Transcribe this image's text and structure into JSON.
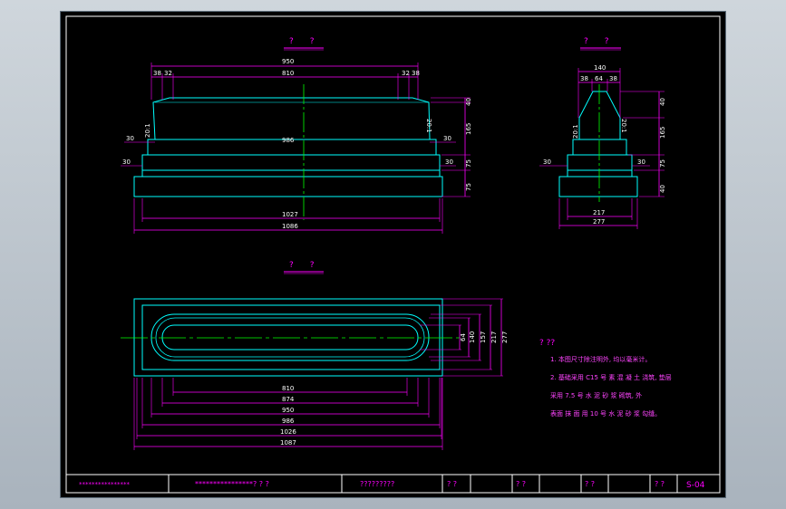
{
  "colors": {
    "background": "#000000",
    "frame": "#ffffff",
    "outline": "#00ffff",
    "dimension": "#ff00ff",
    "centerline": "#00ff00",
    "text": "#ffffff"
  },
  "views": {
    "front_title": "?　　?",
    "side_title": "?　　?",
    "plan_title": "?　　?"
  },
  "front_dims": {
    "top_width": "950",
    "inner_width": "810",
    "left_38": "38",
    "left_32": "32",
    "right_32": "32",
    "right_38": "38",
    "slope_left": "20:1",
    "slope_right": "20:1",
    "shoulder_left": "30",
    "shoulder_right": "30",
    "mid_width": "986",
    "base_width": "1027",
    "overall_width": "1086",
    "h_40": "40",
    "h_165": "165",
    "h_75a": "75",
    "h_75b": "75"
  },
  "side_dims": {
    "top_width": "140",
    "d38a": "38",
    "d64": "64",
    "d38b": "38",
    "slope_left": "20:1",
    "slope_right": "20:1",
    "step_left": "30",
    "step_right": "30",
    "h_40": "40",
    "h_165": "165",
    "h_75": "75",
    "h_40b": "40",
    "width_217": "217",
    "width_277": "277"
  },
  "plan_dims": {
    "w810": "810",
    "w874": "874",
    "w950": "950",
    "w986": "986",
    "w1026": "1026",
    "w1087": "1087",
    "v64": "64",
    "v140": "140",
    "v157": "157",
    "v217": "217",
    "v277": "277"
  },
  "notes": {
    "heading": "? ??",
    "line1": "1. 本图尺寸除注明外, 均以毫米计。",
    "line2": "2. 基础采用 C15 号 素 混 凝 土 浇筑, 垫层",
    "line3": "   采用 7.5 号 水 泥 砂 浆 砌筑, 外",
    "line4": "   表面 抹 面 用 10 号 水 泥 砂 浆 勾缝。"
  },
  "title_block": {
    "cell1": "****************",
    "cell2": "****************? ? ?",
    "cell3": "?????????",
    "cell4": "? ?",
    "cell5": "? ?",
    "cell6": "? ?",
    "cell7": "? ?",
    "drawing_no": "S-04"
  }
}
